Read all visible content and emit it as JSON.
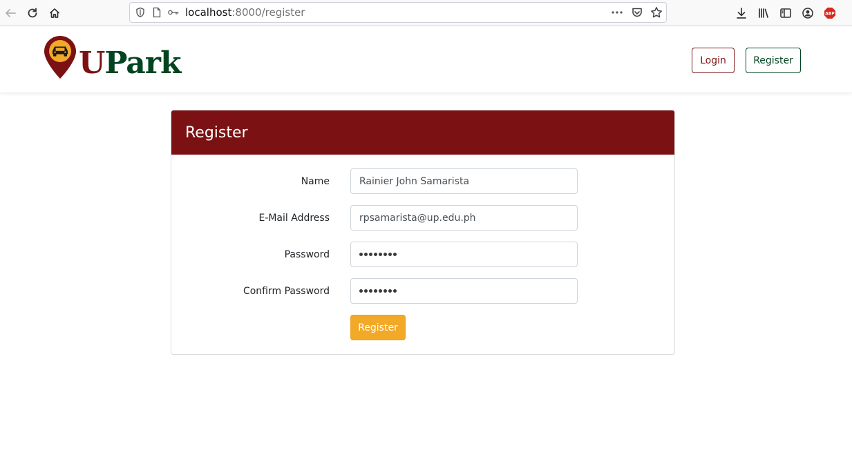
{
  "browser": {
    "url_host": "localhost",
    "url_rest": ":8000/register"
  },
  "navbar": {
    "brand_u": "U",
    "brand_park": "Park",
    "login_label": "Login",
    "register_label": "Register"
  },
  "card": {
    "title": "Register",
    "fields": {
      "name": {
        "label": "Name",
        "value": "Rainier John Samarista"
      },
      "email": {
        "label": "E-Mail Address",
        "value": "rpsamarista@up.edu.ph"
      },
      "password": {
        "label": "Password",
        "masked_length": 8
      },
      "confirm_password": {
        "label": "Confirm Password",
        "masked_length": 8
      }
    },
    "submit_label": "Register"
  },
  "colors": {
    "maroon": "#7b1113",
    "green": "#014421",
    "gold": "#f2a928"
  },
  "icons": [
    "back-arrow-icon",
    "reload-icon",
    "home-icon",
    "shield-icon",
    "page-icon",
    "key-icon",
    "more-icon",
    "pocket-icon",
    "star-icon",
    "download-icon",
    "library-icon",
    "sidebar-icon",
    "account-icon",
    "adblock-icon",
    "car-pin-icon"
  ]
}
